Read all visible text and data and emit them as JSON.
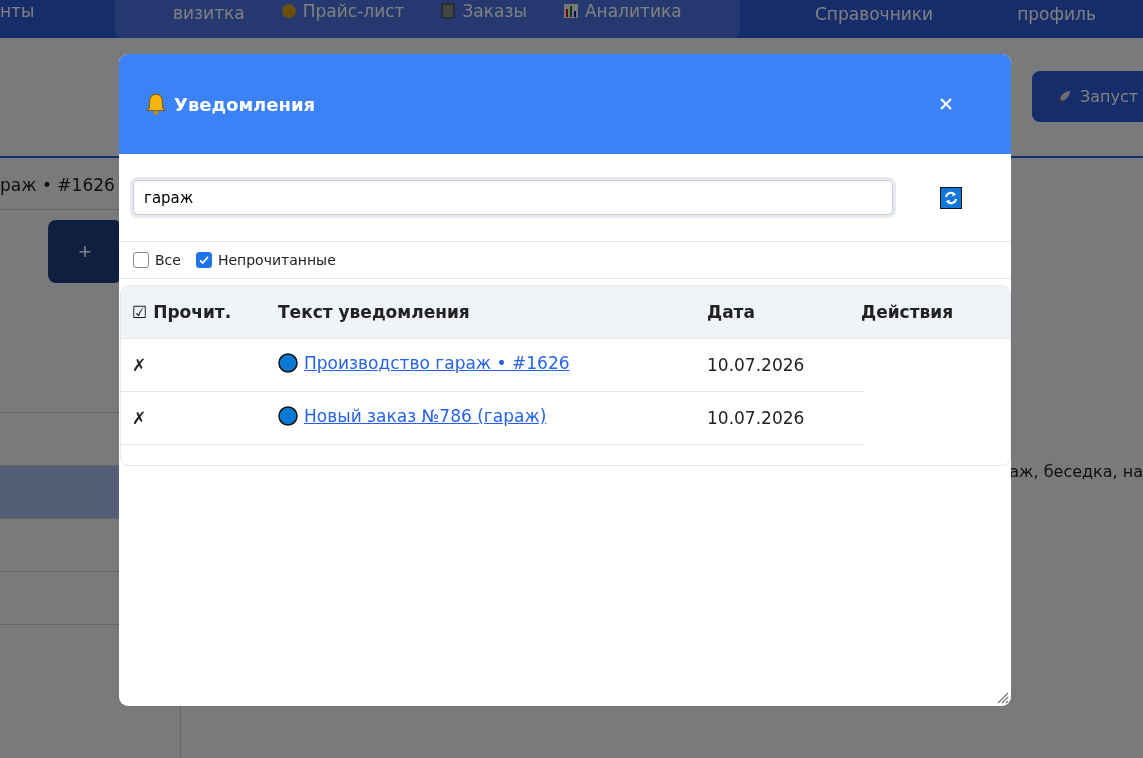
{
  "background": {
    "nav_items": [
      {
        "label": "нты"
      },
      {
        "label": "визитка"
      },
      {
        "label": "Прайс-лист"
      },
      {
        "label": "Заказы"
      },
      {
        "label": "Аналитика"
      }
    ],
    "nav_right": [
      "Справочники",
      "профиль"
    ],
    "launch_button": "Запуст",
    "chat_title": "раж • #1626",
    "add_button": "+",
    "sidebar_rows": [
      {
        "selected": false
      },
      {
        "selected": false
      },
      {
        "selected": true
      },
      {
        "selected": false
      },
      {
        "selected": false
      }
    ],
    "message_fragment": "аж, беседка, на"
  },
  "dialog": {
    "title": "Уведомления",
    "search": {
      "value": "гараж"
    },
    "filters": [
      {
        "label": "Все",
        "checked": false
      },
      {
        "label": "Непрочитанные",
        "checked": true
      }
    ],
    "table": {
      "columns": [
        "☑ Прочит.",
        "Текст уведомления",
        "Дата",
        "Действия"
      ],
      "rows": [
        {
          "read_mark": "✗",
          "text": "Производство гараж • #1626",
          "date": "10.07.2026"
        },
        {
          "read_mark": "✗",
          "text": "Новый заказ №786 (гараж)",
          "date": "10.07.2026"
        }
      ]
    }
  }
}
